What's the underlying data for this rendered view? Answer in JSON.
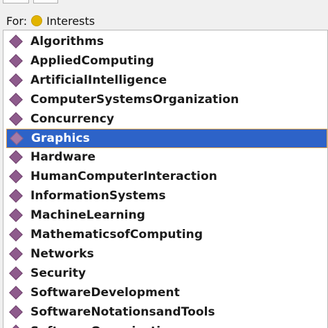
{
  "header": {
    "for_label": "For:",
    "context_name": "Interests",
    "context_dot_color": "#e2b400"
  },
  "colors": {
    "selection_background": "#2d63c8",
    "selection_border": "#e8a04a",
    "item_icon": "#8e5b8c"
  },
  "list": {
    "selected_index": 5,
    "items": [
      {
        "label": "Algorithms",
        "icon": "diamond-icon"
      },
      {
        "label": "AppliedComputing",
        "icon": "diamond-icon"
      },
      {
        "label": "ArtificialIntelligence",
        "icon": "diamond-icon"
      },
      {
        "label": "ComputerSystemsOrganization",
        "icon": "diamond-icon"
      },
      {
        "label": "Concurrency",
        "icon": "diamond-icon"
      },
      {
        "label": "Graphics",
        "icon": "diamond-icon"
      },
      {
        "label": "Hardware",
        "icon": "diamond-icon"
      },
      {
        "label": "HumanComputerInteraction",
        "icon": "diamond-icon"
      },
      {
        "label": "InformationSystems",
        "icon": "diamond-icon"
      },
      {
        "label": "MachineLearning",
        "icon": "diamond-icon"
      },
      {
        "label": "MathematicsofComputing",
        "icon": "diamond-icon"
      },
      {
        "label": "Networks",
        "icon": "diamond-icon"
      },
      {
        "label": "Security",
        "icon": "diamond-icon"
      },
      {
        "label": "SoftwareDevelopment",
        "icon": "diamond-icon"
      },
      {
        "label": "SoftwareNotationsandTools",
        "icon": "diamond-icon"
      },
      {
        "label": "SoftwareOrganization",
        "icon": "diamond-icon"
      }
    ]
  }
}
